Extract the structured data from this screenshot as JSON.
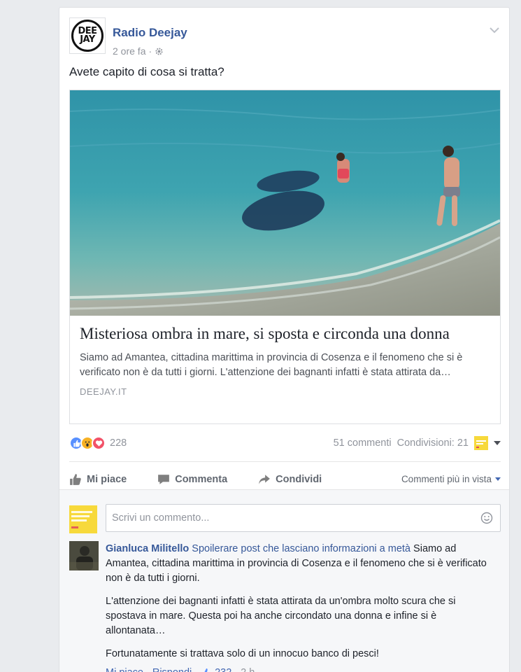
{
  "post": {
    "page_name": "Radio Deejay",
    "logo_text_top": "DEE",
    "logo_text_bottom": "JAY",
    "time": "2 ore fa",
    "separator": "·",
    "privacy_icon": "gear-icon",
    "text": "Avete capito di cosa si tratta?"
  },
  "link": {
    "title": "Misteriosa ombra in mare, si sposta e circonda una donna",
    "description": "Siamo ad Amantea, cittadina marittima in provincia di Cosenza e il fenomeno che si è verificato non è da tutti i giorni. L'attenzione dei bagnanti infatti è stata attirata da…",
    "domain": "DEEJAY.IT"
  },
  "stats": {
    "reaction_icons": [
      "like-icon",
      "wow-icon",
      "love-icon"
    ],
    "reactions_count": "228",
    "comments": "51 commenti",
    "shares": "Condivisioni: 21"
  },
  "actions": {
    "like": "Mi piace",
    "comment": "Commenta",
    "share": "Condividi",
    "sort": "Commenti più in vista"
  },
  "composer": {
    "placeholder": "Scrivi un commento..."
  },
  "comment": {
    "author": "Gianluca Militello",
    "page_link": "Spoilerare post che lasciano informazioni a metà",
    "text_1": "Siamo ad Amantea, cittadina marittima in provincia di Cosenza e il fenomeno che si è verificato non è da tutti i giorni.",
    "text_2": "L'attenzione dei bagnanti infatti è stata attirata da un'ombra molto scura che si spostava in mare. Questa poi ha anche circondato una donna e infine si è allontanata…",
    "text_3": "Fortunatamente si trattava solo di un innocuo banco di pesci!",
    "like": "Mi piace",
    "reply": "Rispondi",
    "likes": "232",
    "time": "2 h",
    "dot": "·"
  },
  "colors": {
    "link_blue": "#365899",
    "background": "#e9ebee",
    "like_blue": "#5890ff",
    "love_red": "#f25268",
    "wow_yellow": "#f7b125"
  }
}
